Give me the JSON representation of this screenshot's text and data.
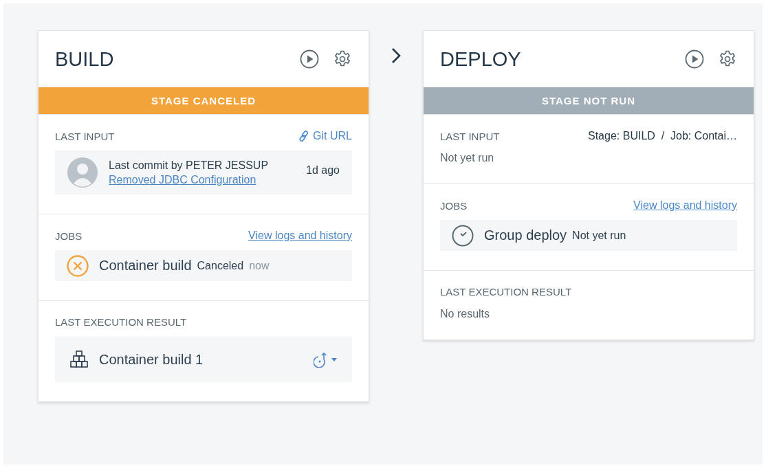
{
  "stages": [
    {
      "title": "BUILD",
      "status": {
        "kind": "canceled",
        "label": "STAGE CANCELED"
      },
      "last_input": {
        "label": "LAST INPUT",
        "link": "Git URL",
        "commit": {
          "author_line": "Last commit by PETER JESSUP",
          "time": "1d ago",
          "message": "Removed JDBC Configuration"
        }
      },
      "jobs": {
        "label": "JOBS",
        "link": "View logs and history",
        "items": [
          {
            "kind": "canceled",
            "name": "Container build",
            "status": "Canceled",
            "time": "now"
          }
        ]
      },
      "last_execution": {
        "label": "LAST EXECUTION RESULT",
        "result": {
          "name": "Container build 1"
        }
      }
    },
    {
      "title": "DEPLOY",
      "status": {
        "kind": "not-run",
        "label": "STAGE NOT RUN"
      },
      "last_input": {
        "label": "LAST INPUT",
        "source": "Stage: BUILD  /  Job: Contai…",
        "text": "Not yet run"
      },
      "jobs": {
        "label": "JOBS",
        "link": "View logs and history",
        "items": [
          {
            "kind": "pending",
            "name": "Group deploy",
            "status": "Not yet run"
          }
        ]
      },
      "last_execution": {
        "label": "LAST EXECUTION RESULT",
        "empty_text": "No results"
      }
    }
  ]
}
